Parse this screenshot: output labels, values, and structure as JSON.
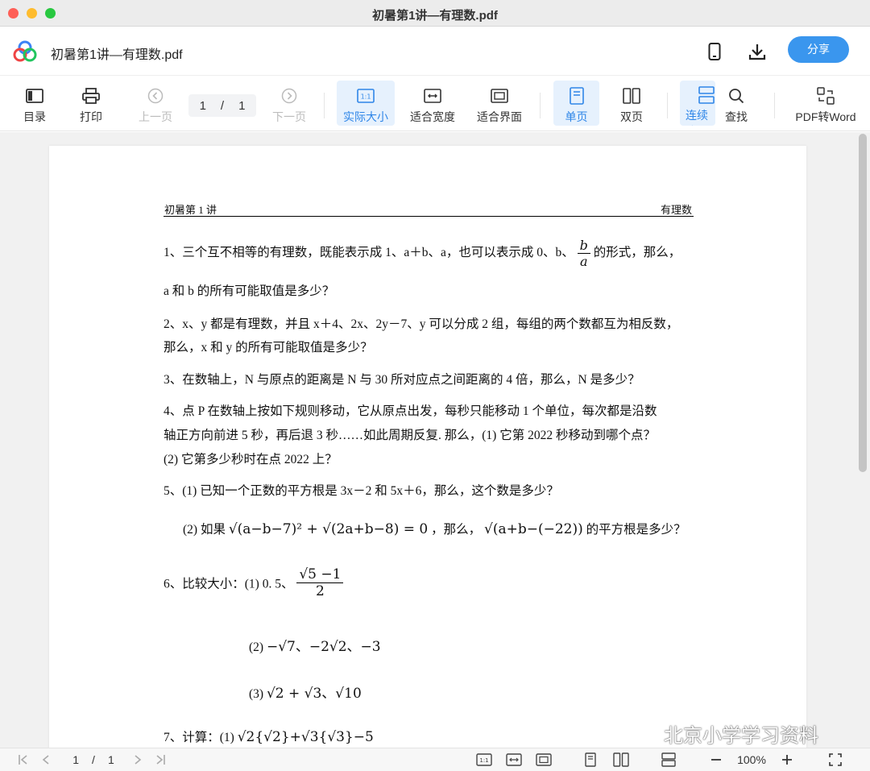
{
  "window": {
    "title": "初暑第1讲—有理数.pdf"
  },
  "header": {
    "doc_title": "初暑第1讲—有理数.pdf",
    "share_label": "分享",
    "phone_icon": "phone-icon",
    "download_icon": "download-icon"
  },
  "toolbar": {
    "toc": "目录",
    "print": "打印",
    "prev_page": "上一页",
    "page_current": "1",
    "page_sep": "/",
    "page_total": "1",
    "next_page": "下一页",
    "actual_size": "实际大小",
    "fit_width": "适合宽度",
    "fit_screen": "适合界面",
    "single_page": "单页",
    "double_page": "双页",
    "continuous": "连续滚",
    "find": "查找",
    "pdf_to_word": "PDF转Word"
  },
  "document": {
    "header_left": "初暑第 1 讲",
    "header_right": "有理数",
    "q1_a": "1、三个互不相等的有理数，既能表示成 1、a＋b、a，也可以表示成 0、b、",
    "q1_frac_num": "b",
    "q1_frac_den": "a",
    "q1_b": "的形式，那么，",
    "q1_c": "a 和 b 的所有可能取值是多少？",
    "q2_a": "2、x、y 都是有理数，并且 x＋4、2x、2y－7、y 可以分成 2 组，每组的两个数都互为相反数，",
    "q2_b": "那么，x 和 y 的所有可能取值是多少？",
    "q3": "3、在数轴上，N 与原点的距离是 N 与 30 所对应点之间距离的 4 倍，那么，N 是多少？",
    "q4_a": "4、点 P 在数轴上按如下规则移动，它从原点出发，每秒只能移动 1 个单位，每次都是沿数",
    "q4_b": "轴正方向前进 5 秒，再后退 3 秒……如此周期反复. 那么，(1) 它第 2022 秒移动到哪个点？",
    "q4_c": "(2) 它第多少秒时在点 2022 上？",
    "q5_a": "5、(1) 已知一个正数的平方根是 3x－2 和 5x＋6，那么，这个数是多少？",
    "q5_b_pre": "(2) 如果",
    "q5_b_math1": "√(a−b−7)² + √(2a+b−8) = 0",
    "q5_b_mid": "，那么，",
    "q5_b_math2": "√(a+b−(−22))",
    "q5_b_post": "的平方根是多少？",
    "q6_a": "6、比较大小：(1) 0. 5、",
    "q6_frac_num": "√5 −1",
    "q6_frac_den": "2",
    "q6_b_label": "(2)",
    "q6_b_math": "−√7、−2√2、−3",
    "q6_c_label": "(3)",
    "q6_c_math": "√2 + √3、√10",
    "q7_pre": "7、计算：(1)",
    "q7_math": "√2{√2}+√3{√3}−5"
  },
  "bottombar": {
    "page_current": "1",
    "page_sep": "/",
    "page_total": "1",
    "zoom": "100%"
  },
  "watermark": "北京小学学习资料",
  "colors": {
    "accent": "#3a96ee",
    "active_bg": "#e6f1fd"
  }
}
